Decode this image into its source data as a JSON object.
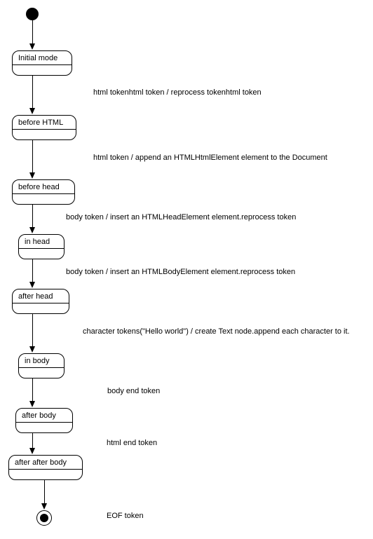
{
  "chart_data": {
    "type": "state-diagram",
    "title": "",
    "nodes": [
      {
        "id": "start",
        "kind": "initial",
        "label": ""
      },
      {
        "id": "s1",
        "kind": "state",
        "label": "Initial mode"
      },
      {
        "id": "s2",
        "kind": "state",
        "label": "before HTML"
      },
      {
        "id": "s3",
        "kind": "state",
        "label": "before head"
      },
      {
        "id": "s4",
        "kind": "state",
        "label": "in head"
      },
      {
        "id": "s5",
        "kind": "state",
        "label": "after head"
      },
      {
        "id": "s6",
        "kind": "state",
        "label": "in body"
      },
      {
        "id": "s7",
        "kind": "state",
        "label": "after body"
      },
      {
        "id": "s8",
        "kind": "state",
        "label": "after after body"
      },
      {
        "id": "end",
        "kind": "final",
        "label": ""
      }
    ],
    "edges": [
      {
        "from": "start",
        "to": "s1",
        "label": ""
      },
      {
        "from": "s1",
        "to": "s2",
        "label": "html tokenhtml token / reprocess tokenhtml token"
      },
      {
        "from": "s2",
        "to": "s3",
        "label": "html token / append an HTMLHtmlElement element to the Document"
      },
      {
        "from": "s3",
        "to": "s4",
        "label": "body token / insert an HTMLHeadElement element.reprocess token"
      },
      {
        "from": "s4",
        "to": "s5",
        "label": "body token / insert an HTMLBodyElement element.reprocess token"
      },
      {
        "from": "s5",
        "to": "s6",
        "label": "character tokens(\"Hello world\") / create Text node.append each character to it."
      },
      {
        "from": "s6",
        "to": "s7",
        "label": "body end token"
      },
      {
        "from": "s7",
        "to": "s8",
        "label": "html end token"
      },
      {
        "from": "s8",
        "to": "end",
        "label": "EOF token"
      }
    ]
  }
}
